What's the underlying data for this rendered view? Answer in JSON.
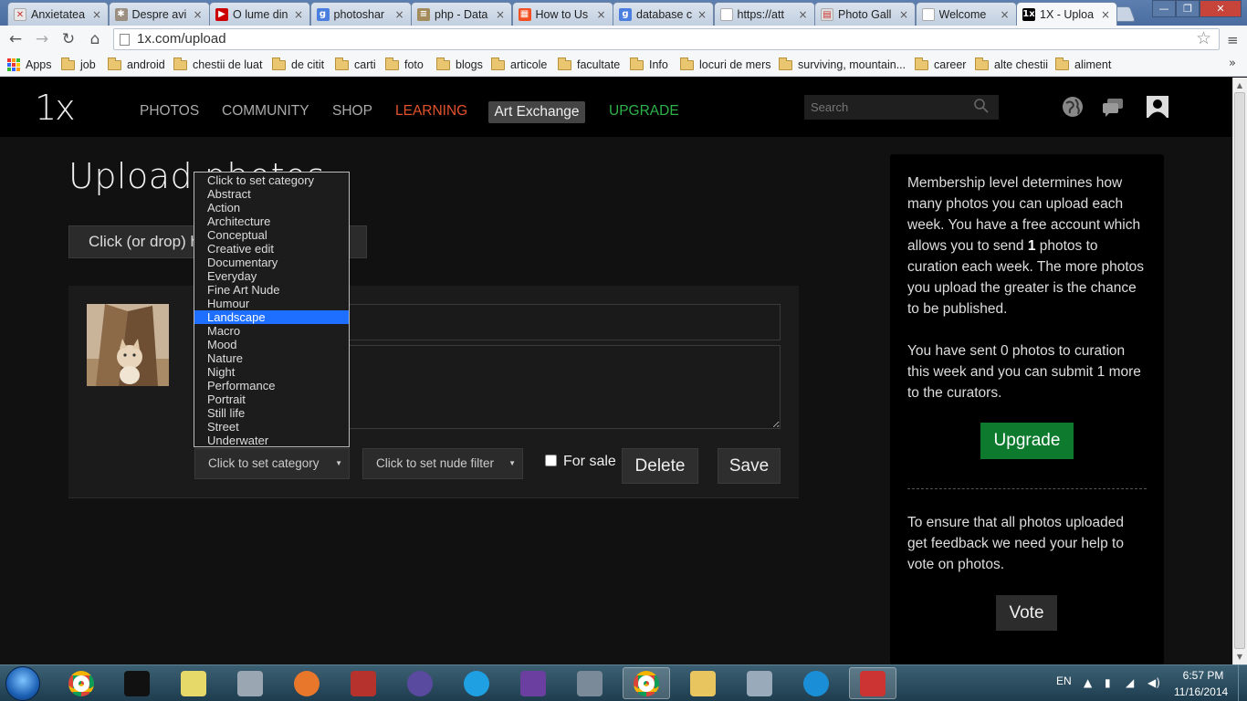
{
  "browser": {
    "tabs": [
      {
        "title": "Anxietatea",
        "favicon_color": "#e8e8e8",
        "favicon_glyph": "✕"
      },
      {
        "title": "Despre avi",
        "favicon_color": "#9a8f80",
        "favicon_glyph": "✱"
      },
      {
        "title": "O lume din",
        "favicon_color": "#cc0000",
        "favicon_glyph": "▶"
      },
      {
        "title": "photoshar",
        "favicon_color": "#4a7fe0",
        "favicon_glyph": "g"
      },
      {
        "title": "php - Data",
        "favicon_color": "#a38b5c",
        "favicon_glyph": "≡"
      },
      {
        "title": "How to Us",
        "favicon_color": "#f25022",
        "favicon_glyph": "▦"
      },
      {
        "title": "database c",
        "favicon_color": "#4a7fe0",
        "favicon_glyph": "g"
      },
      {
        "title": "https://att",
        "favicon_color": "#ffffff",
        "favicon_glyph": ""
      },
      {
        "title": "Photo Gall",
        "favicon_color": "#dddddd",
        "favicon_glyph": "▤"
      },
      {
        "title": "Welcome",
        "favicon_color": "#ffffff",
        "favicon_glyph": ""
      },
      {
        "title": "1X - Uploa",
        "favicon_color": "#000000",
        "favicon_glyph": "1x"
      }
    ],
    "tab_close_glyph": "×",
    "window_controls": {
      "minimize": "—",
      "maximize": "❐",
      "close": "✕"
    },
    "nav": {
      "back": "←",
      "forward": "→",
      "reload": "↻",
      "home": "⌂",
      "star": "☆",
      "menu": "≡"
    },
    "url": "1x.com/upload",
    "bookmarks": [
      "Apps",
      "job",
      "android",
      "chestii de luat",
      "de citit",
      "carti",
      "foto",
      "blogs",
      "articole",
      "facultate",
      "Info",
      "locuri de mers",
      "surviving, mountain...",
      "career",
      "alte chestii",
      "aliment"
    ],
    "bookmarks_more": "»"
  },
  "site": {
    "logo": "1x",
    "nav": {
      "photos": "PHOTOS",
      "community": "COMMUNITY",
      "shop": "SHOP",
      "learning": "LEARNING",
      "art_exchange": "Art Exchange",
      "upgrade": "UPGRADE"
    },
    "colors": {
      "learning": "#e2522c",
      "upgrade": "#2eb24a",
      "upgrade_button": "#0e7a2e",
      "selected_option": "#1e6fff"
    },
    "search_placeholder": "Search",
    "icons": [
      "globe-icon",
      "chat-icon",
      "profile-icon"
    ]
  },
  "upload": {
    "title": "Upload photos",
    "dropzone_label": "Click (or drop) here to upload photos",
    "category_select": "Click to set category",
    "nude_filter_select": "Click to set nude filter",
    "for_sale_label": "For sale",
    "for_sale_checked": false,
    "delete_label": "Delete",
    "save_label": "Save",
    "category_options": [
      "Click to set category",
      "Abstract",
      "Action",
      "Architecture",
      "Conceptual",
      "Creative edit",
      "Documentary",
      "Everyday",
      "Fine Art Nude",
      "Humour",
      "Landscape",
      "Macro",
      "Mood",
      "Nature",
      "Night",
      "Performance",
      "Portrait",
      "Still life",
      "Street",
      "Underwater"
    ],
    "highlighted_option": "Landscape"
  },
  "sidebar": {
    "membership_before": "Membership level determines how many photos you can upload each week. You have a free account which allows you to send ",
    "membership_count": "1",
    "membership_after": " photos to curation each week. The more photos you upload the greater is the chance to be published.",
    "sent_text": "You have sent 0 photos to curation this week and you can submit 1 more to the curators.",
    "upgrade_label": "Upgrade",
    "vote_text": "To ensure that all photos uploaded get feedback we need your help to vote on photos.",
    "vote_label": "Vote"
  },
  "taskbar": {
    "apps": [
      "chrome-icon",
      "cmd-icon",
      "sticky-notes-icon",
      "calculator-icon",
      "firefox-icon",
      "winrar-icon",
      "eclipse-icon",
      "skype-icon",
      "visual-studio-icon",
      "sql-server-icon",
      "chrome-icon-2",
      "explorer-icon",
      "virtualbox-icon",
      "internet-explorer-icon",
      "snipping-tool-icon"
    ],
    "language": "EN",
    "time": "6:57 PM",
    "date": "11/16/2014"
  }
}
